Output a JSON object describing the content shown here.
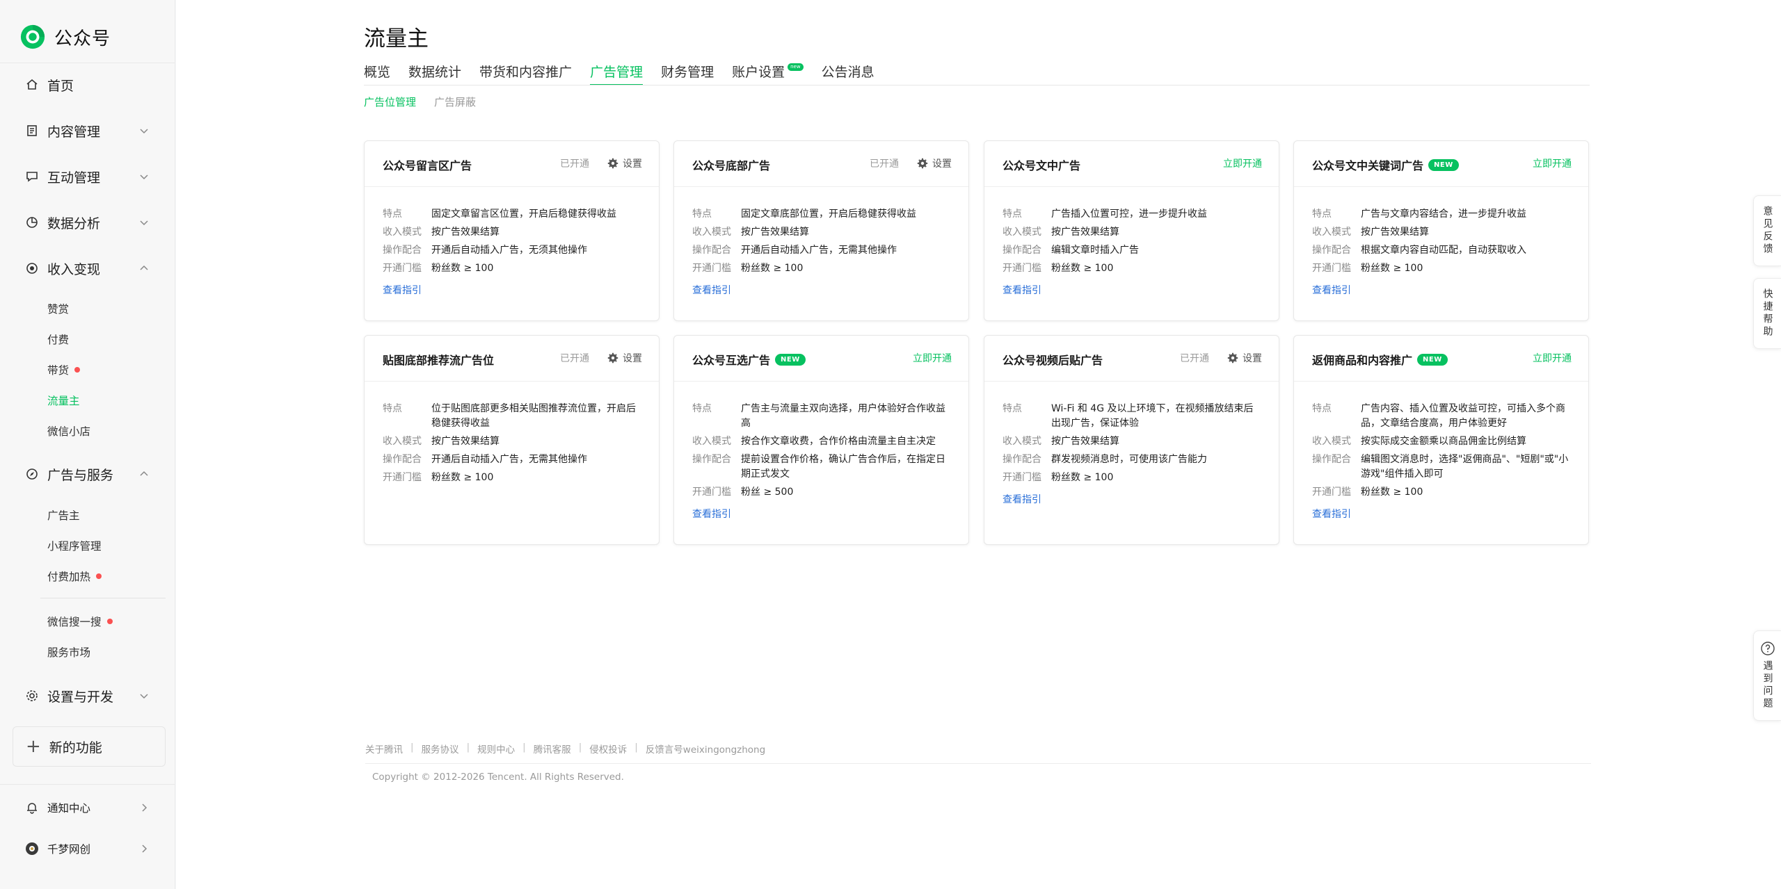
{
  "brand": {
    "name": "公众号",
    "color": "#07c160"
  },
  "sidebar": {
    "items": [
      {
        "label": "首页",
        "icon": "home-icon"
      },
      {
        "label": "内容管理",
        "icon": "document-icon"
      },
      {
        "label": "互动管理",
        "icon": "chat-icon"
      },
      {
        "label": "数据分析",
        "icon": "pie-chart-icon"
      },
      {
        "label": "收入变现",
        "icon": "coin-icon"
      },
      {
        "label": "广告与服务",
        "icon": "compass-icon"
      },
      {
        "label": "设置与开发",
        "icon": "gear-icon"
      }
    ],
    "income_sub": [
      {
        "label": "赞赏"
      },
      {
        "label": "付费"
      },
      {
        "label": "带货"
      },
      {
        "label": "流量主"
      },
      {
        "label": "微信小店"
      }
    ],
    "ads_sub": [
      {
        "label": "广告主"
      },
      {
        "label": "小程序管理"
      },
      {
        "label": "付费加热"
      },
      {
        "label": "微信搜一搜"
      },
      {
        "label": "服务市场"
      }
    ],
    "new_feature": "新的功能",
    "notification": "通知中心",
    "account": "千梦网创"
  },
  "page": {
    "title": "流量主",
    "tabs": [
      "概览",
      "数据统计",
      "带货和内容推广",
      "广告管理",
      "财务管理",
      "账户设置",
      "公告消息"
    ],
    "tab_badge": "new",
    "subtabs": [
      "广告位管理",
      "广告屏蔽"
    ]
  },
  "labels": {
    "feature": "特点",
    "income": "收入模式",
    "operation": "操作配合",
    "threshold": "开通门槛",
    "enabled": "已开通",
    "settings": "设置",
    "open_now": "立即开通",
    "guide": "查看指引",
    "new_badge": "NEW"
  },
  "cards": [
    {
      "title": "公众号留言区广告",
      "feature": "固定文章留言区位置，开启后稳健获得收益",
      "income": "按广告效果结算",
      "operation": "开通后自动插入广告，无须其他操作",
      "threshold": "粉丝数 ≥ 100"
    },
    {
      "title": "公众号底部广告",
      "feature": "固定文章底部位置，开启后稳健获得收益",
      "income": "按广告效果结算",
      "operation": "开通后自动插入广告，无需其他操作",
      "threshold": "粉丝数 ≥ 100"
    },
    {
      "title": "公众号文中广告",
      "feature": "广告插入位置可控，进一步提升收益",
      "income": "按广告效果结算",
      "operation": "编辑文章时插入广告",
      "threshold": "粉丝数 ≥ 100"
    },
    {
      "title": "公众号文中关键词广告",
      "feature": "广告与文章内容结合，进一步提升收益",
      "income": "按广告效果结算",
      "operation": "根据文章内容自动匹配，自动获取收入",
      "threshold": "粉丝数 ≥ 100"
    },
    {
      "title": "贴图底部推荐流广告位",
      "feature": "位于贴图底部更多相关贴图推荐流位置，开启后稳健获得收益",
      "income": "按广告效果结算",
      "operation": "开通后自动插入广告，无需其他操作",
      "threshold": "粉丝数 ≥ 100"
    },
    {
      "title": "公众号互选广告",
      "feature": "广告主与流量主双向选择，用户体验好合作收益高",
      "income": "按合作文章收费，合作价格由流量主自主决定",
      "operation": "提前设置合作价格，确认广告合作后，在指定日期正式发文",
      "threshold": "粉丝 ≥ 500"
    },
    {
      "title": "公众号视频后贴广告",
      "feature": "Wi-Fi 和 4G 及以上环境下，在视频播放结束后出现广告，保证体验",
      "income": "按广告效果结算",
      "operation": "群发视频消息时，可使用该广告能力",
      "threshold": "粉丝数 ≥ 100"
    },
    {
      "title": "返佣商品和内容推广",
      "feature": "广告内容、插入位置及收益可控，可插入多个商品，文章结合度高，用户体验更好",
      "income": "按实际成交金额乘以商品佣金比例结算",
      "operation": "编辑图文消息时，选择\"返佣商品\"、\"短剧\"或\"小游戏\"组件插入即可",
      "threshold": "粉丝数 ≥ 100"
    }
  ],
  "footer": {
    "links": [
      "关于腾讯",
      "服务协议",
      "规则中心",
      "腾讯客服",
      "侵权投诉",
      "反馈言号weixingongzhong"
    ],
    "copyright": "Copyright © 2012-2026 Tencent. All Rights Reserved."
  },
  "float": {
    "feedback": "意见反馈",
    "help": "快捷帮助",
    "problem": "遇到问题"
  }
}
